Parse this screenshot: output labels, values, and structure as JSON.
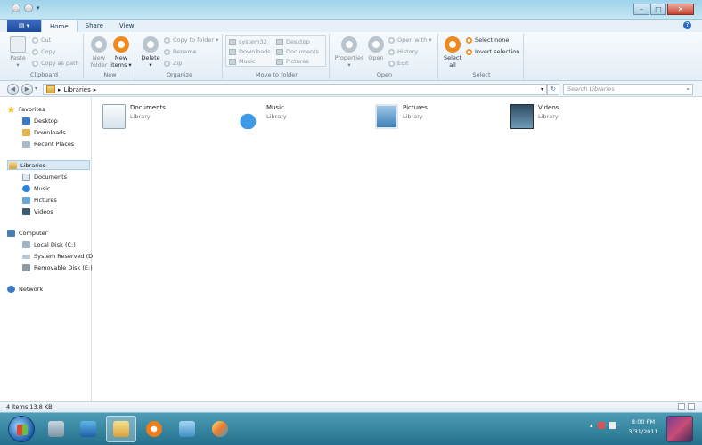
{
  "ribbon_tabs": {
    "file": "",
    "home": "Home",
    "share": "Share",
    "view": "View"
  },
  "clipboard": {
    "paste": "Paste",
    "cut": "Cut",
    "copy": "Copy",
    "copy_as_path": "Copy as path",
    "group": "Clipboard"
  },
  "new": {
    "new_folder_1": "New",
    "new_folder_2": "folder",
    "new_items_1": "New",
    "new_items_2": "items ▾",
    "group": "New"
  },
  "organize": {
    "delete": "Delete",
    "copy_to_folder": "Copy to folder ▾",
    "rename": "Rename",
    "zip": "Zip",
    "group": "Organize"
  },
  "move_to_folder": {
    "items": [
      "system32",
      "Desktop",
      "Downloads",
      "Documents",
      "Music",
      "Pictures"
    ],
    "group": "Move to folder"
  },
  "open": {
    "properties": "Properties",
    "open": "Open",
    "open_with": "Open with ▾",
    "history": "History",
    "edit": "Edit",
    "group": "Open"
  },
  "select": {
    "select_all_1": "Select",
    "select_all_2": "all",
    "select_none": "Select none",
    "invert_selection": "Invert selection",
    "group": "Select"
  },
  "address": {
    "path": "Libraries",
    "separator": "▸",
    "search_placeholder": "Search Libraries"
  },
  "nav_pane": {
    "favorites": "Favorites",
    "desktop": "Desktop",
    "downloads": "Downloads",
    "recent_places": "Recent Places",
    "libraries": "Libraries",
    "documents": "Documents",
    "music": "Music",
    "pictures": "Pictures",
    "videos": "Videos",
    "computer": "Computer",
    "local_disk": "Local Disk (C:)",
    "system_reserved": "System Reserved (D:",
    "removable_disk": "Removable Disk (E:)",
    "network": "Network"
  },
  "libraries": [
    {
      "name": "Documents",
      "type": "Library",
      "icon": "documents-library-icon"
    },
    {
      "name": "Music",
      "type": "Library",
      "icon": "music-library-icon"
    },
    {
      "name": "Pictures",
      "type": "Library",
      "icon": "pictures-library-icon"
    },
    {
      "name": "Videos",
      "type": "Library",
      "icon": "videos-library-icon"
    }
  ],
  "status": {
    "text": "4 items 13.8 KB"
  },
  "taskbar": {
    "time": "8:00 PM",
    "date": "3/31/2011"
  },
  "colors": {
    "accent": "#2b6dc2",
    "orange": "#f08a1c",
    "taskbar": "#2f7f9b"
  }
}
